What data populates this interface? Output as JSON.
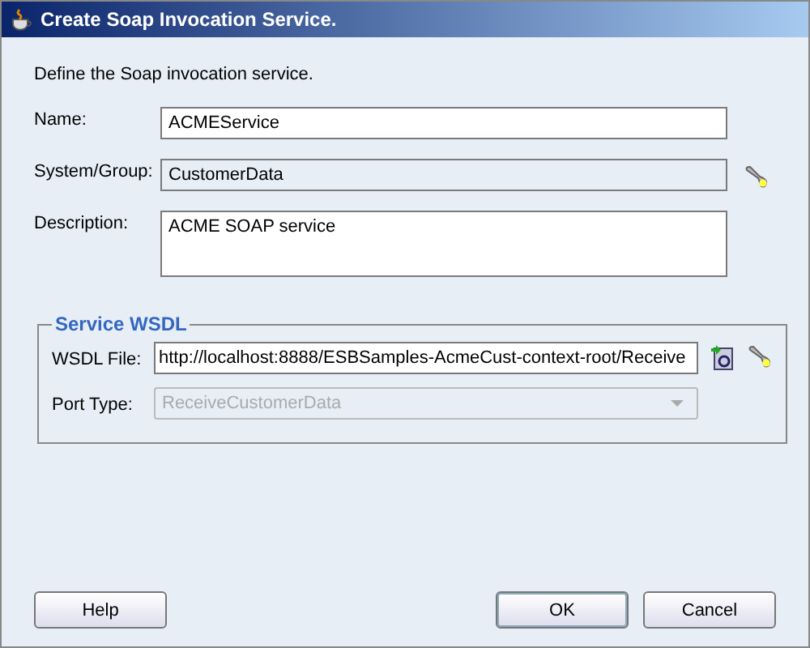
{
  "window": {
    "title": "Create Soap Invocation Service."
  },
  "intro": "Define the Soap invocation service.",
  "fields": [
    {
      "label": "Name:",
      "value": "ACMEService",
      "kind": "text"
    },
    {
      "label": "System/Group:",
      "value": "CustomerData",
      "kind": "readonly"
    },
    {
      "label": "Description:",
      "value": "ACME SOAP service",
      "kind": "textarea"
    }
  ],
  "wsdl_group": {
    "title": "Service WSDL",
    "fields": [
      {
        "label": "WSDL File:",
        "value": "http://localhost:8888/ESBSamples-AcmeCust-context-root/Receive",
        "kind": "text",
        "disabled": false
      },
      {
        "label": "Port Type:",
        "value": "ReceiveCustomerData",
        "kind": "combo",
        "disabled": true
      }
    ]
  },
  "buttons": [
    {
      "label": "Help",
      "default": false
    },
    {
      "label": "OK",
      "default": true
    },
    {
      "label": "Cancel",
      "default": false
    }
  ]
}
